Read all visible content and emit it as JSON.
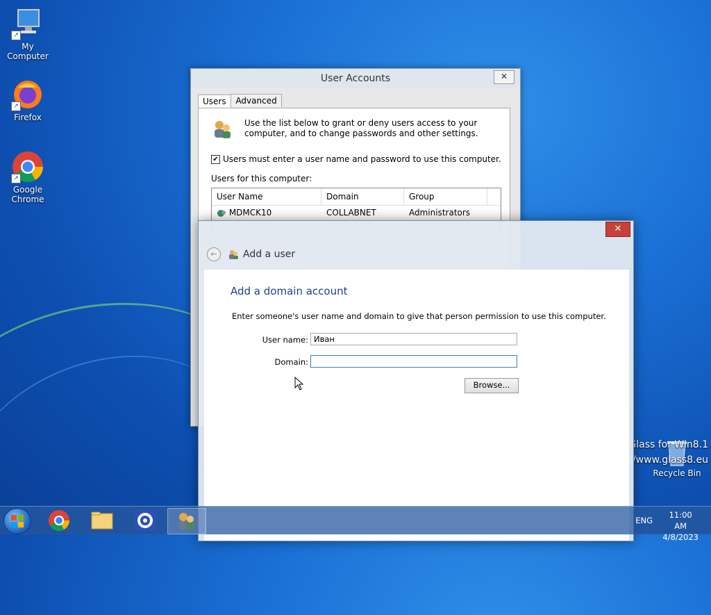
{
  "desktop": {
    "icons": [
      {
        "label": "My Computer"
      },
      {
        "label": "Firefox"
      },
      {
        "label": "Google Chrome"
      },
      {
        "label": "Recycle Bin"
      }
    ],
    "watermark": [
      "Glass for Win8.1",
      "//www.glass8.eu"
    ]
  },
  "user_accounts": {
    "title": "User Accounts",
    "close": "✕",
    "tabs": [
      {
        "label": "Users"
      },
      {
        "label": "Advanced"
      }
    ],
    "intro": "Use the list below to grant or deny users access to your computer, and to change passwords and other settings.",
    "require_login_label": "Users must enter a user name and password to use this computer.",
    "require_login_checked": true,
    "users_label": "Users for this computer:",
    "columns": [
      "User Name",
      "Domain",
      "Group"
    ],
    "rows": [
      {
        "user": "MDMCK10",
        "domain": "COLLABNET",
        "group": "Administrators"
      }
    ]
  },
  "add_user": {
    "close": "✕",
    "nav_title": "Add a user",
    "heading": "Add a domain account",
    "description": "Enter someone's user name and domain to give that person permission to use this computer.",
    "user_name_label": "User name:",
    "user_name_value": "Иван",
    "domain_label": "Domain:",
    "domain_value": "",
    "browse_label": "Browse..."
  },
  "taskbar": {
    "language": "ENG",
    "time": "11:00 AM",
    "date": "4/8/2023"
  },
  "colors": {
    "heading": "#1e3f8a",
    "close_red": "#c7413a",
    "taskbar": "#285aa0"
  }
}
